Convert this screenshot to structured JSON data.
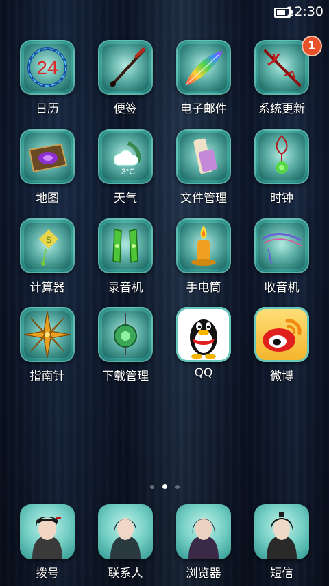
{
  "status_bar": {
    "time": "12:30",
    "battery_icon": "battery-icon"
  },
  "apps": [
    {
      "id": "calendar",
      "label": "日历",
      "icon": "calendar-icon",
      "icon_text": "24"
    },
    {
      "id": "notes",
      "label": "便签",
      "icon": "brush-icon"
    },
    {
      "id": "email",
      "label": "电子邮件",
      "icon": "feather-icon"
    },
    {
      "id": "system-update",
      "label": "系统更新",
      "icon": "trident-icon",
      "badge": "1"
    },
    {
      "id": "map",
      "label": "地图",
      "icon": "scroll-map-icon"
    },
    {
      "id": "weather",
      "label": "天气",
      "icon": "cloud-icon",
      "icon_text": "3°C"
    },
    {
      "id": "file-manager",
      "label": "文件管理",
      "icon": "scroll-icon"
    },
    {
      "id": "clock",
      "label": "时钟",
      "icon": "pendant-icon"
    },
    {
      "id": "calculator",
      "label": "计算器",
      "icon": "lantern-icon"
    },
    {
      "id": "recorder",
      "label": "录音机",
      "icon": "bracers-icon"
    },
    {
      "id": "flashlight",
      "label": "手电筒",
      "icon": "candle-icon"
    },
    {
      "id": "radio",
      "label": "收音机",
      "icon": "ribbon-icon"
    },
    {
      "id": "compass",
      "label": "指南针",
      "icon": "compass-star-icon"
    },
    {
      "id": "download-manager",
      "label": "下载管理",
      "icon": "jade-pendant-icon"
    },
    {
      "id": "qq",
      "label": "QQ",
      "icon": "qq-penguin-icon"
    },
    {
      "id": "weibo",
      "label": "微博",
      "icon": "weibo-icon"
    }
  ],
  "pager": {
    "pages": 3,
    "current": 2
  },
  "dock": [
    {
      "id": "dialer",
      "label": "拨号",
      "icon": "avatar-girl-icon"
    },
    {
      "id": "contacts",
      "label": "联系人",
      "icon": "avatar-swordsman-icon"
    },
    {
      "id": "browser",
      "label": "浏览器",
      "icon": "avatar-warrior-icon"
    },
    {
      "id": "messages",
      "label": "短信",
      "icon": "avatar-scholar-icon"
    }
  ],
  "colors": {
    "badge": "#e8502a",
    "icon_frame": "#5cc0b4",
    "background": "#0c162a"
  }
}
